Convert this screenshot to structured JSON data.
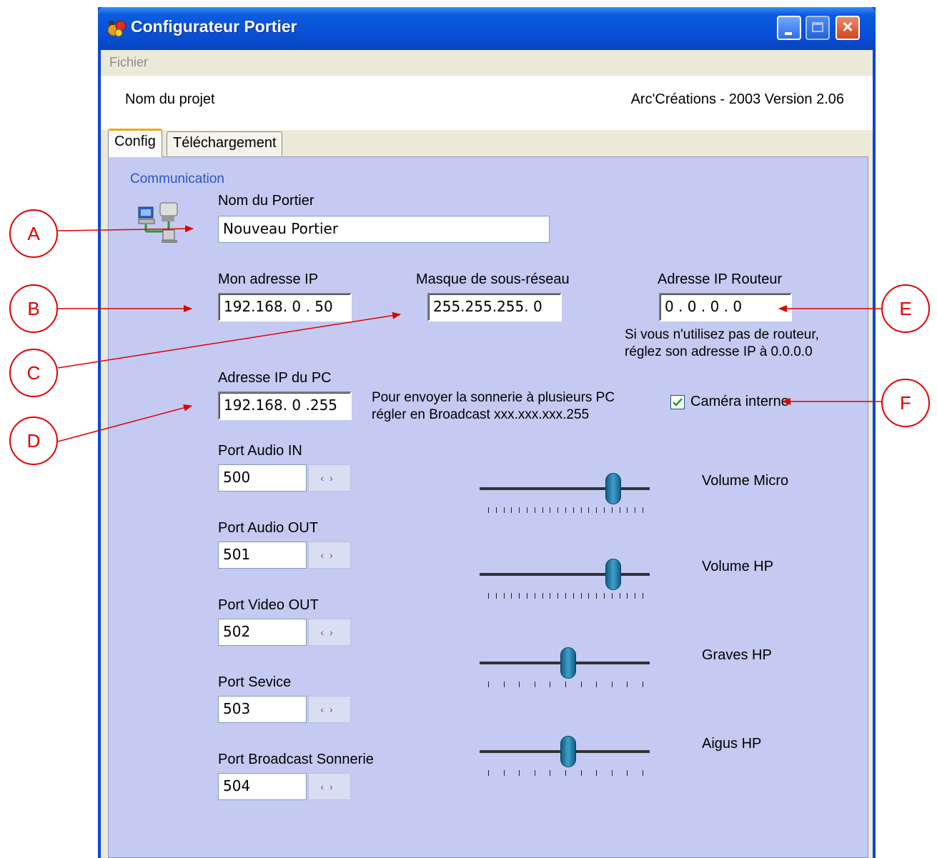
{
  "window": {
    "title": "Configurateur Portier",
    "controls": {
      "minimize": "minimize",
      "maximize": "maximize",
      "close": "close"
    }
  },
  "menu": {
    "file": "Fichier"
  },
  "header": {
    "project_name": "Nom du projet",
    "version": "Arc'Créations - 2003  Version 2.06"
  },
  "tabs": [
    {
      "label": "Config"
    },
    {
      "label": "Téléchargement"
    }
  ],
  "group": {
    "title": "Communication"
  },
  "fields": {
    "door_name": {
      "label": "Nom du Portier",
      "value": "Nouveau Portier"
    },
    "my_ip": {
      "label": "Mon adresse IP",
      "value": "192.168.  0 . 50"
    },
    "subnet": {
      "label": "Masque de sous-réseau",
      "value": "255.255.255.  0"
    },
    "router_ip": {
      "label": "Adresse IP Routeur",
      "value": " 0  .  0  .  0  .  0"
    },
    "router_hint_1": "Si vous n'utilisez pas de routeur,",
    "router_hint_2": "réglez son adresse IP à 0.0.0.0",
    "pc_ip": {
      "label": "Adresse IP du PC",
      "value": "192.168.  0 .255"
    },
    "broadcast_hint_1": "Pour envoyer la sonnerie à plusieurs PC",
    "broadcast_hint_2": "régler en Broadcast xxx.xxx.xxx.255",
    "camera": {
      "label": "Caméra interne",
      "checked": true
    }
  },
  "ports": [
    {
      "label": "Port Audio IN",
      "value": "500"
    },
    {
      "label": "Port Audio OUT",
      "value": "501"
    },
    {
      "label": "Port Video OUT",
      "value": "502"
    },
    {
      "label": "Port Sevice",
      "value": "503"
    },
    {
      "label": "Port Broadcast Sonnerie",
      "value": "504"
    }
  ],
  "sliders": [
    {
      "label": "Volume Micro",
      "level": 0.81,
      "ticks": 21
    },
    {
      "label": "Volume HP",
      "level": 0.81,
      "ticks": 21
    },
    {
      "label": "Graves HP",
      "level": 0.52,
      "ticks": 11
    },
    {
      "label": "Aigus HP",
      "level": 0.52,
      "ticks": 11
    }
  ],
  "annotations": [
    "A",
    "B",
    "C",
    "D",
    "E",
    "F"
  ],
  "colors": {
    "title_bar": "#0a50d6",
    "panel": "#c5caf2",
    "annotation": "#e00000",
    "tab_highlight": "#f3a60d"
  },
  "icons": {
    "app": "app-icon",
    "network": "network-computers-icon"
  }
}
